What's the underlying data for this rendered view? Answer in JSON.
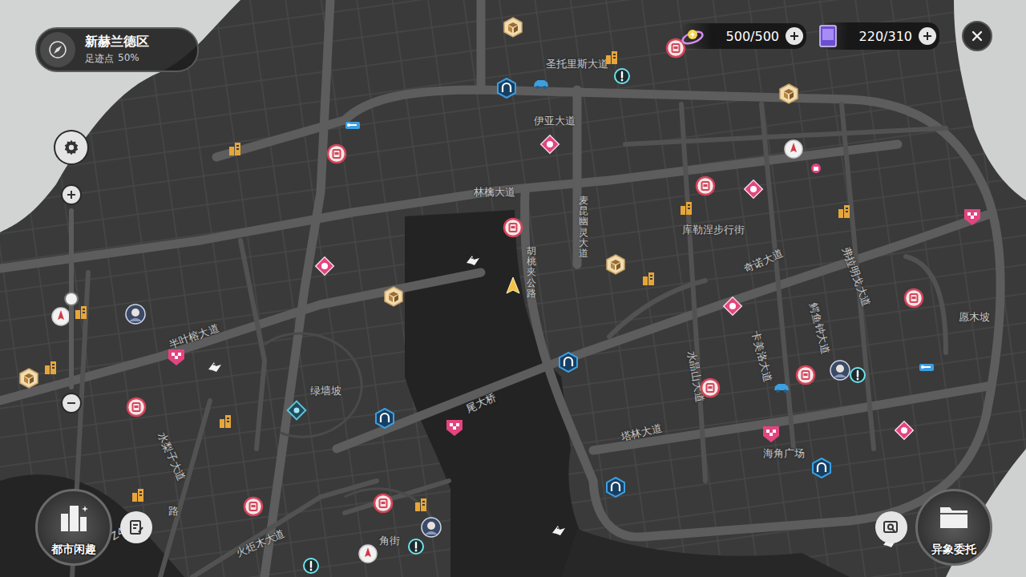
{
  "header": {
    "district": "新赫兰德区",
    "footprint_label": "足迹点",
    "footprint_value": "50%"
  },
  "resources": [
    {
      "value": "500/500"
    },
    {
      "value": "220/310"
    }
  ],
  "zoom": {
    "level": 0.5
  },
  "streets": [
    {
      "label": "圣托里斯大道",
      "kind": "horizontal"
    },
    {
      "label": "伊亚大道",
      "kind": "horizontal"
    },
    {
      "label": "林檎大道",
      "kind": "horizontal"
    },
    {
      "label": "麦昆幽灵大道",
      "kind": "vertical"
    },
    {
      "label": "胡桃夹公路",
      "kind": "vertical"
    },
    {
      "label": "库勒涅步行街",
      "kind": "horizontal"
    },
    {
      "label": "奇诺大道",
      "kind": "horizontal"
    },
    {
      "label": "弗拉明戈大道",
      "kind": "horizontal"
    },
    {
      "label": "鳄鱼钟大道",
      "kind": "horizontal"
    },
    {
      "label": "卡美洛大道",
      "kind": "horizontal"
    },
    {
      "label": "水晶山大道",
      "kind": "horizontal"
    },
    {
      "label": "塔林大道",
      "kind": "horizontal"
    },
    {
      "label": "海角广场",
      "kind": "horizontal"
    },
    {
      "label": "愿木坡",
      "kind": "horizontal"
    },
    {
      "label": "绿墙坡",
      "kind": "horizontal"
    },
    {
      "label": "半叶榕大道",
      "kind": "horizontal"
    },
    {
      "label": "水梨子大道",
      "kind": "horizontal"
    },
    {
      "label": "火炬木大道",
      "kind": "horizontal"
    },
    {
      "label": "尾大桥",
      "kind": "horizontal"
    },
    {
      "label": "角街",
      "kind": "horizontal"
    },
    {
      "label": "Z42",
      "kind": "horizontal"
    },
    {
      "label": "路",
      "kind": "horizontal"
    }
  ],
  "pins": [
    {
      "kind": "shop"
    },
    {
      "kind": "shop"
    },
    {
      "kind": "shop"
    },
    {
      "kind": "shop"
    },
    {
      "kind": "shop"
    },
    {
      "kind": "shop"
    },
    {
      "kind": "shop"
    },
    {
      "kind": "shop"
    },
    {
      "kind": "shop"
    },
    {
      "kind": "shop"
    },
    {
      "kind": "diamond"
    },
    {
      "kind": "diamond"
    },
    {
      "kind": "diamond"
    },
    {
      "kind": "diamond"
    },
    {
      "kind": "diamond"
    },
    {
      "kind": "checker"
    },
    {
      "kind": "checker"
    },
    {
      "kind": "checker"
    },
    {
      "kind": "checker"
    },
    {
      "kind": "gate"
    },
    {
      "kind": "gate"
    },
    {
      "kind": "gate"
    },
    {
      "kind": "gate"
    },
    {
      "kind": "gate"
    },
    {
      "kind": "crate"
    },
    {
      "kind": "crate"
    },
    {
      "kind": "crate"
    },
    {
      "kind": "crate"
    },
    {
      "kind": "crate"
    },
    {
      "kind": "building"
    },
    {
      "kind": "building"
    },
    {
      "kind": "building"
    },
    {
      "kind": "building"
    },
    {
      "kind": "building"
    },
    {
      "kind": "building"
    },
    {
      "kind": "building"
    },
    {
      "kind": "building"
    },
    {
      "kind": "building"
    },
    {
      "kind": "building"
    },
    {
      "kind": "rocket"
    },
    {
      "kind": "rocket"
    },
    {
      "kind": "rocket"
    },
    {
      "kind": "alert"
    },
    {
      "kind": "alert"
    },
    {
      "kind": "alert"
    },
    {
      "kind": "alert"
    },
    {
      "kind": "car"
    },
    {
      "kind": "car"
    },
    {
      "kind": "wrench"
    },
    {
      "kind": "wrench"
    },
    {
      "kind": "avatar"
    },
    {
      "kind": "avatar"
    },
    {
      "kind": "avatar"
    },
    {
      "kind": "bird"
    },
    {
      "kind": "bird"
    },
    {
      "kind": "bird"
    },
    {
      "kind": "bird"
    },
    {
      "kind": "player"
    },
    {
      "kind": "emblem"
    },
    {
      "kind": "gift"
    }
  ],
  "buttons": {
    "city": "都市闲趣",
    "commission": "异象委托"
  }
}
